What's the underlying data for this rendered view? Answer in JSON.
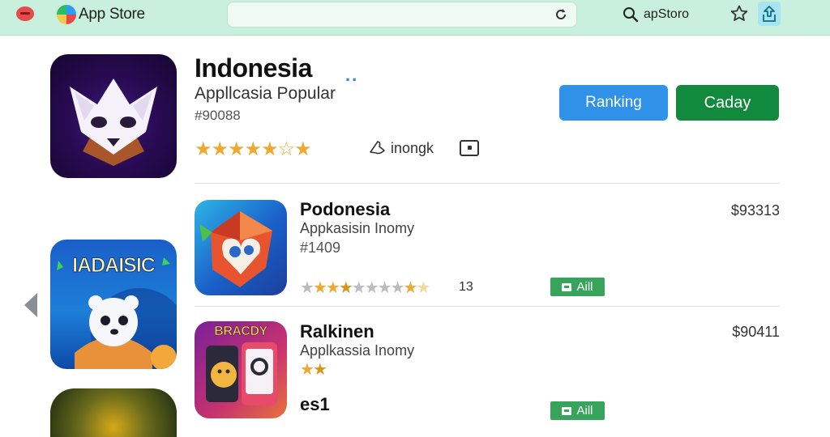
{
  "topbar": {
    "brand": "App Store",
    "search_text": "apStoro"
  },
  "featured": {
    "title": "Indonesia",
    "more": "..",
    "subtitle": "Appllcasia Popular",
    "number": "#90088",
    "stars": [
      "full",
      "full",
      "full",
      "full",
      "half",
      "empty",
      "half"
    ],
    "link_label": "inongk",
    "ranking_label": "Ranking",
    "primary_label": "Caday"
  },
  "carousel": {
    "card1_title": "IADAISIC"
  },
  "apps": [
    {
      "title": "Podonesia",
      "subtitle": "Appkasisin Inomy",
      "number": "#1409",
      "stars": [
        "gray",
        "full",
        "full",
        "half",
        "gray",
        "gray",
        "gray",
        "gray",
        "full",
        "light"
      ],
      "count": "13",
      "price": "$93313",
      "get_label": "Aill"
    },
    {
      "title": "Ralkinen",
      "subtitle": "Applkassia Inomy",
      "number": "",
      "stars": [
        "full",
        "half"
      ],
      "count": "",
      "price": "$90411",
      "icon_title": "BRACDY"
    },
    {
      "title": "es1",
      "get_label": "Aill"
    }
  ],
  "colors": {
    "topbar_bg": "#c9f0dc",
    "ranking_button": "#2f92e8",
    "primary_button": "#118a3e",
    "get_button": "#38a35a",
    "star": "#f0a92e"
  }
}
